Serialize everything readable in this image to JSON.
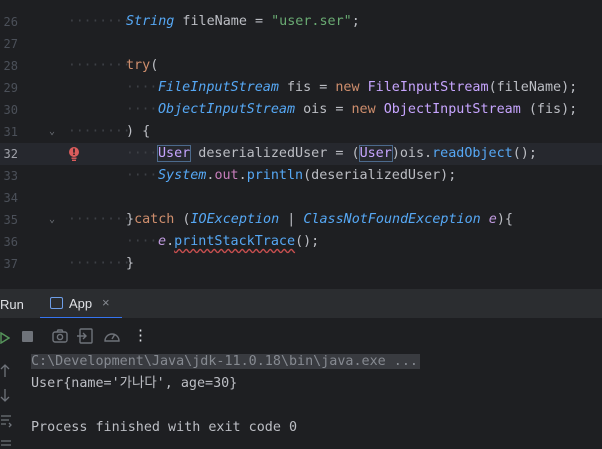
{
  "editor": {
    "lines": [
      {
        "num": "26"
      },
      {
        "num": "27"
      },
      {
        "num": "28"
      },
      {
        "num": "29"
      },
      {
        "num": "30"
      },
      {
        "num": "31"
      },
      {
        "num": "32"
      },
      {
        "num": "33"
      },
      {
        "num": "34"
      },
      {
        "num": "35"
      },
      {
        "num": "36"
      },
      {
        "num": "37"
      }
    ],
    "code": {
      "l25_type": "String",
      "l25_var": " fileName = ",
      "l25_str": "\"user.ser\"",
      "l25_end": ";",
      "l27_try": "try",
      "l27_paren": "(",
      "l28_type": "FileInputStream",
      "l28_var": " fis = ",
      "l28_new": "new",
      "l28_ctor": " FileInputStream",
      "l28_args": "(fileName);",
      "l29_type": "ObjectInputStream",
      "l29_var": " ois = ",
      "l29_new": "new",
      "l29_ctor": " ObjectInputStream",
      "l29_args": " (fis);",
      "l30_text": ") {",
      "l31_type": "User",
      "l31_var": " deserializedUser = (",
      "l31_cast": "User",
      "l31_obj": ")ois.",
      "l31_fn": "readObject",
      "l31_end": "();",
      "l32_sys": "System",
      "l32_dot1": ".",
      "l32_out": "out",
      "l32_dot2": ".",
      "l32_fn": "println",
      "l32_args": "(deserializedUser);",
      "l34_brace": "}",
      "l34_catch": "catch",
      "l34_open": " (",
      "l34_ex1": "IOException",
      "l34_pipe": " | ",
      "l34_ex2": "ClassNotFoundException",
      "l34_param": " e",
      "l34_close": "){",
      "l35_e": "e",
      "l35_dot": ".",
      "l35_fn": "printStackTrace",
      "l35_end": "();",
      "l36_text": "}"
    }
  },
  "run_panel": {
    "label": "Run",
    "tab_label": "App",
    "tab_close": "×",
    "more_icon": "⋮"
  },
  "console": {
    "command": "C:\\Development\\Java\\jdk-11.0.18\\bin\\java.exe ...",
    "output": "User{name='가나다', age=30}",
    "exit": "Process finished with exit code 0"
  },
  "colors": {
    "background": "#1e1f22",
    "panel": "#2b2d30",
    "accent": "#3574f0",
    "keyword": "#cf8e6d",
    "string": "#6aab73",
    "method": "#56a8f5"
  }
}
